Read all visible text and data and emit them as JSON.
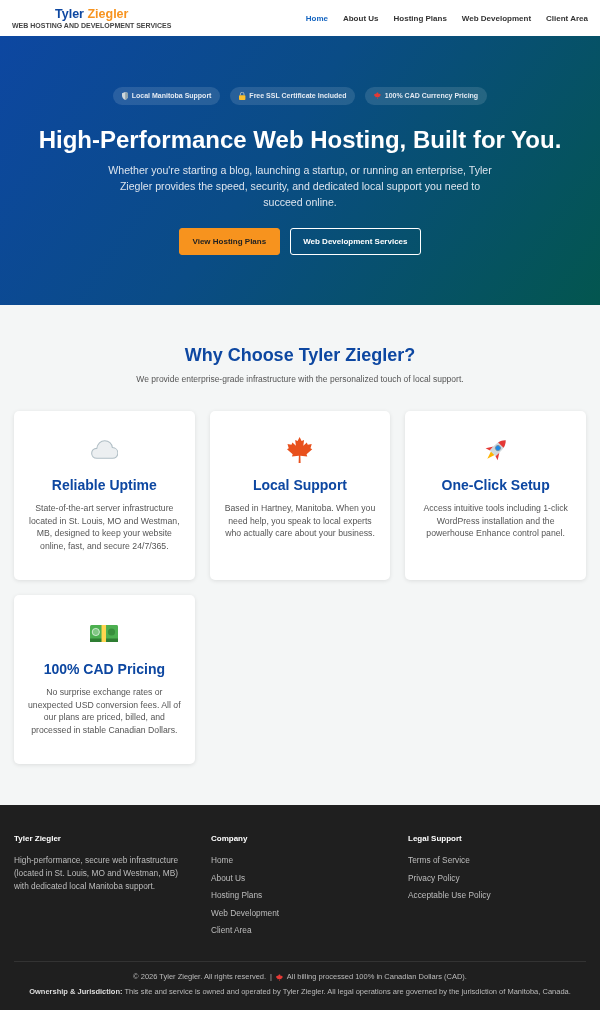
{
  "header": {
    "logo": {
      "first": "Tyler",
      "second": "Ziegler"
    },
    "tagline": "WEB HOSTING AND DEVELOPMENT SERVICES",
    "nav": [
      {
        "label": "Home",
        "selected": true
      },
      {
        "label": "About Us",
        "selected": false
      },
      {
        "label": "Hosting Plans",
        "selected": false
      },
      {
        "label": "Web Development",
        "selected": false
      },
      {
        "label": "Client Area",
        "selected": false
      }
    ]
  },
  "hero": {
    "badges": [
      "Local Manitoba Support",
      "Free SSL Certificate Included",
      "100% CAD Currency Pricing"
    ],
    "title": "High-Performance Web Hosting, Built for You.",
    "text": "Whether you're starting a blog, launching a startup, or running an enterprise, Tyler Ziegler provides the speed, security, and dedicated local support you need to succeed online.",
    "buttons": [
      {
        "label": "View Hosting Plans",
        "kind": "primary"
      },
      {
        "label": "Web Development Services",
        "kind": "outline"
      }
    ]
  },
  "features": {
    "title": "Why Choose Tyler Ziegler?",
    "subtitle": "We provide enterprise-grade infrastructure with the personalized touch of local support.",
    "cards": [
      {
        "title": "Reliable Uptime",
        "text": "State-of-the-art server infrastructure located in St. Louis, MO and Westman, MB, designed to keep your website online, fast, and secure 24/7/365."
      },
      {
        "title": "Local Support",
        "text": "Based in Hartney, Manitoba. When you need help, you speak to local experts who actually care about your business."
      },
      {
        "title": "One-Click Setup",
        "text": "Access intuitive tools including 1-click WordPress installation and the powerhouse Enhance control panel."
      },
      {
        "title": "100% CAD Pricing",
        "text": "No surprise exchange rates or unexpected USD conversion fees. All of our plans are priced, billed, and processed in stable Canadian Dollars."
      }
    ]
  },
  "footer": {
    "columns": [
      {
        "kind": "about",
        "heading": "Tyler Ziegler",
        "text": "High-performance, secure web infrastructure (located in St. Louis, MO and Westman, MB) with dedicated local Manitoba support."
      },
      {
        "kind": "links",
        "heading": "Company",
        "links": [
          "Home",
          "About Us",
          "Hosting Plans",
          "Web Development",
          "Client Area"
        ]
      },
      {
        "kind": "links",
        "heading": "Legal Support",
        "links": [
          "Terms of Service",
          "Privacy Policy",
          "Acceptable Use Policy"
        ]
      }
    ],
    "copyright": "© 2026 Tyler Ziegler. All rights reserved.",
    "separator": "|",
    "billing": "All billing processed 100% in Canadian Dollars (CAD).",
    "legal": "**Ownership & Jurisdiction:** This site and service is owned and operated by Tyler Ziegler. All legal operations are governed by the jurisdiction of Manitoba, Canada."
  }
}
